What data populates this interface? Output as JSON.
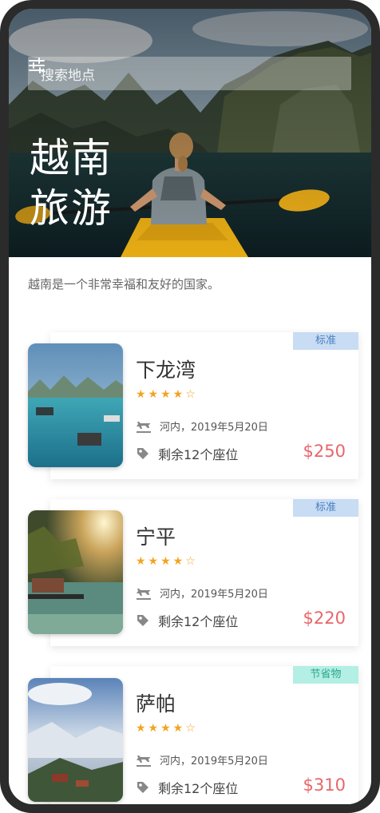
{
  "hero": {
    "search_placeholder": "搜索地点",
    "title_line1": "越南",
    "title_line2": "旅游"
  },
  "intro": "越南是一个非常幸福和友好的国家。",
  "tours": [
    {
      "tag": "标准",
      "tag_color": "#c8dcf3",
      "name": "下龙湾",
      "stars": "★★★★☆",
      "rating": 4,
      "departure": "河内，2019年5月20日",
      "seats": "剩余12个座位",
      "price": "$250"
    },
    {
      "tag": "标准",
      "tag_color": "#c8dcf3",
      "name": "宁平",
      "stars": "★★★★☆",
      "rating": 4,
      "departure": "河内，2019年5月20日",
      "seats": "剩余12个座位",
      "price": "$220"
    },
    {
      "tag": "节省物",
      "tag_color": "#b3efe4",
      "name": "萨帕",
      "stars": "★★★★☆",
      "rating": 4,
      "departure": "河内，2019年5月20日",
      "seats": "剩余12个座位",
      "price": "$310"
    }
  ],
  "colors": {
    "price": "#e8666a",
    "star": "#f3a41f",
    "tag_standard": "#c8dcf3",
    "tag_economy": "#b3efe4"
  },
  "icons": [
    "filter-icon",
    "plane-icon",
    "tag-icon",
    "star-icon"
  ]
}
